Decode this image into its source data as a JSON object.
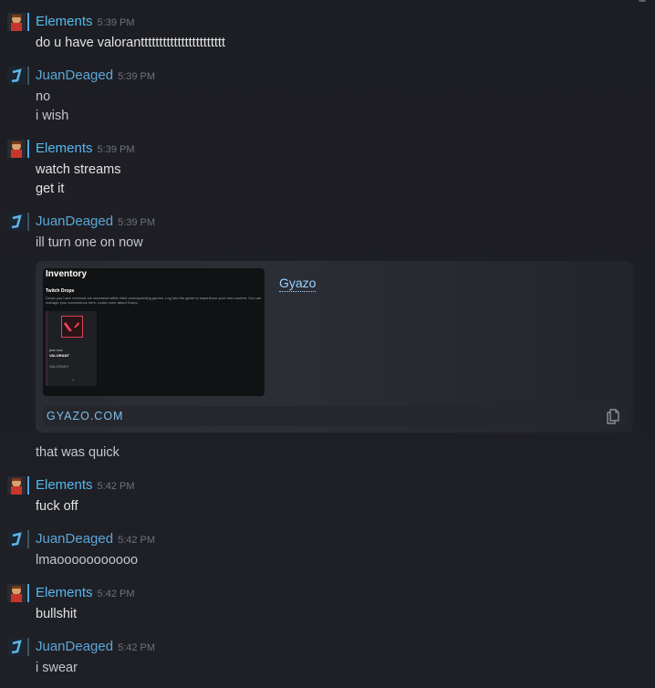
{
  "messages": [
    {
      "user": "Elements",
      "time": "5:39 PM",
      "lines": [
        "do u have valoranttttttttttttttttttttttt"
      ]
    },
    {
      "user": "JuanDeaged",
      "time": "5:39 PM",
      "lines": [
        "no",
        "i wish"
      ]
    },
    {
      "user": "Elements",
      "time": "5:39 PM",
      "lines": [
        "watch streams",
        "get it"
      ]
    },
    {
      "user": "JuanDeaged",
      "time": "5:39 PM",
      "lines": [
        "ill turn one on now"
      ],
      "embed": {
        "title": "Gyazo",
        "domain": "GYAZO.COM",
        "thumbnail": {
          "heading": "Inventory",
          "subheading": "Twitch Drops",
          "description": "Drops you have received are accessed within their corresponding games. Log into the game to experience your new content. You can manage your connections here. Learn more about Drops.",
          "card_time": "just now",
          "card_game": "VALORANT",
          "card_label": "VALORANT",
          "chevron": "⌄"
        }
      },
      "after_lines": [
        "that was quick"
      ]
    },
    {
      "user": "Elements",
      "time": "5:42 PM",
      "lines": [
        "fuck off"
      ]
    },
    {
      "user": "JuanDeaged",
      "time": "5:42 PM",
      "lines": [
        "lmaooooooooooo"
      ]
    },
    {
      "user": "Elements",
      "time": "5:42 PM",
      "lines": [
        "bullshit"
      ]
    },
    {
      "user": "JuanDeaged",
      "time": "5:42 PM",
      "lines": [
        "i swear"
      ]
    }
  ],
  "colors": {
    "Elements_name": "#56b8f0",
    "JuanDeaged_name": "#5aa7d8",
    "Elements_bar": "#4aa8e6",
    "JuanDeaged_bar": "#3e5563"
  },
  "icons": {
    "copy": "copy-icon",
    "corner": "add-reaction-icon"
  }
}
